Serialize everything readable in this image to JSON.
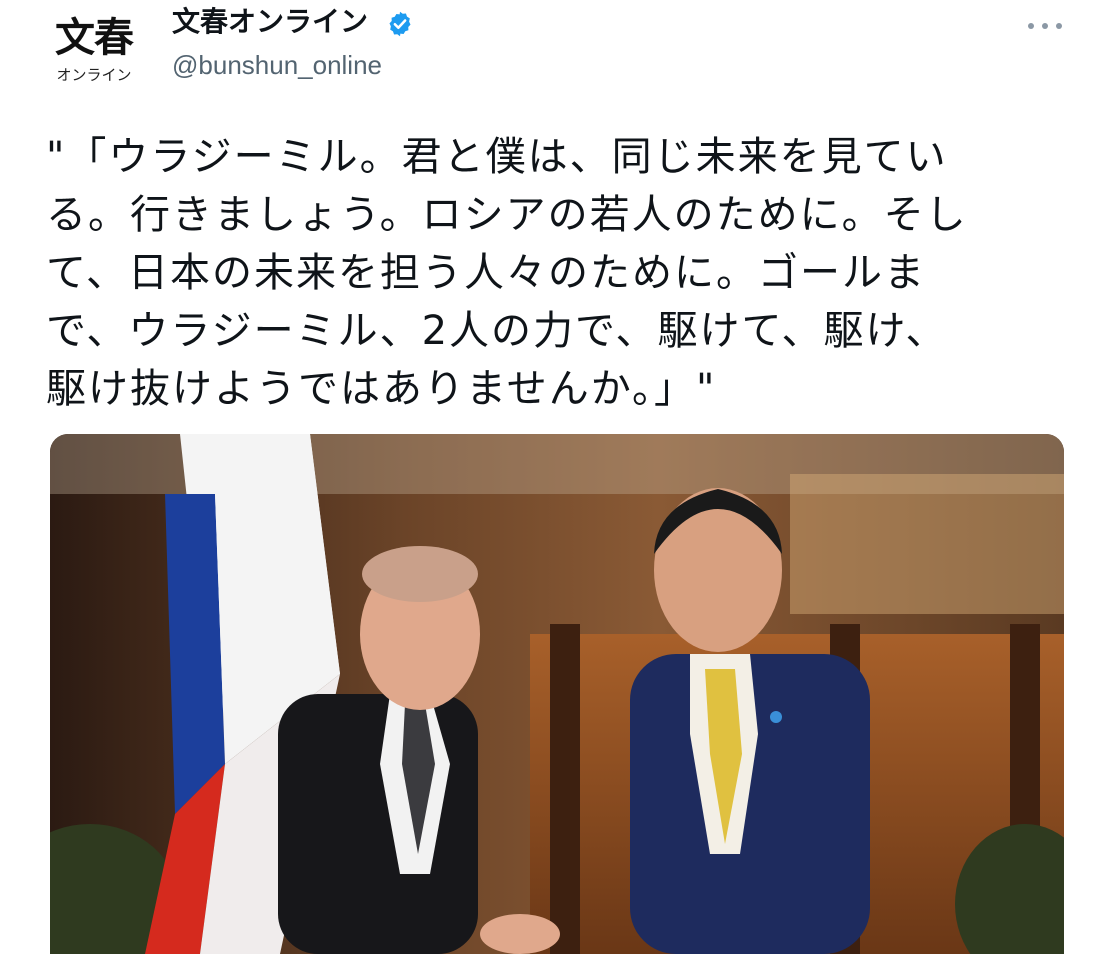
{
  "avatar": {
    "main": "文春",
    "sub": "オンライン"
  },
  "account": {
    "display_name": "文春オンライン",
    "handle": "@bunshun_online",
    "verified_icon": "verified-badge-icon"
  },
  "menu_icon": "more-horizontal-icon",
  "tweet": {
    "lines": [
      "\"「ウラジーミル。君と僕は、同じ未来を見てい",
      "る。行きましょう。ロシアの若人のために。そし",
      "て、日本の未来を担う人々のために。ゴールま",
      "で、ウラジーミル、2人の力で、駆けて、駆け、",
      "駆け抜けようではありませんか。」\""
    ]
  },
  "colors": {
    "verified_blue": "#1d9bf0",
    "handle_gray": "#536471",
    "flag_white": "#f4f4f4",
    "flag_blue": "#1c3f9c",
    "flag_red": "#d52a1e"
  },
  "media": {
    "icon": "photo-image"
  }
}
